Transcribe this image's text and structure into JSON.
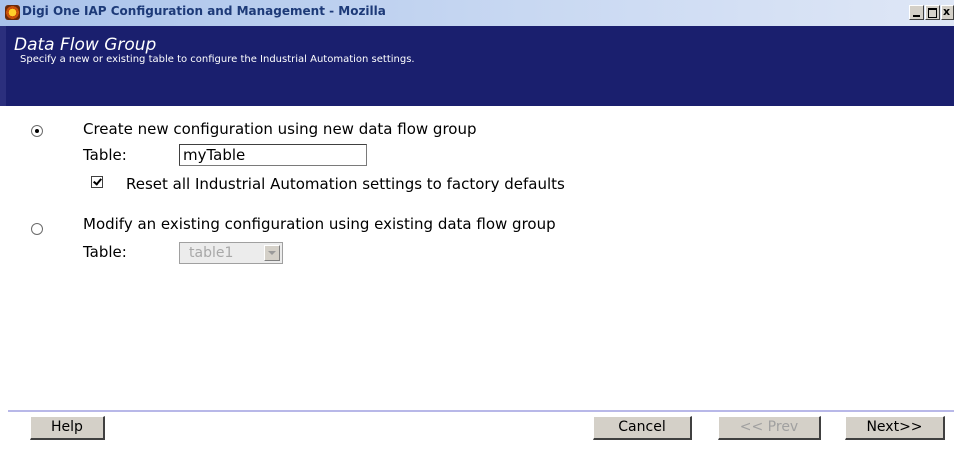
{
  "window": {
    "title": "Digi One IAP Configuration and Management - Mozilla",
    "app_icon": "digi-app-icon",
    "controls": {
      "minimize": "minimize-icon",
      "maximize": "maximize-icon",
      "close_glyph": "x",
      "close": "close-icon"
    }
  },
  "header": {
    "title": "Data Flow Group",
    "subtitle": "Specify a new or existing table to configure the Industrial Automation settings.",
    "background_color": "#1a1f6e"
  },
  "options": {
    "create_new": {
      "label": "Create new configuration using new data flow group",
      "selected": true,
      "table_label": "Table:",
      "table_value": "myTable",
      "reset_checkbox_label": "Reset all Industrial Automation settings to factory defaults",
      "reset_checked": true
    },
    "modify_existing": {
      "label": "Modify an existing configuration using existing data flow group",
      "selected": false,
      "table_label": "Table:",
      "table_selected": "table1",
      "table_disabled": true
    }
  },
  "buttons": {
    "help": "Help",
    "cancel": "Cancel",
    "prev": "<< Prev",
    "next": "Next>>"
  }
}
